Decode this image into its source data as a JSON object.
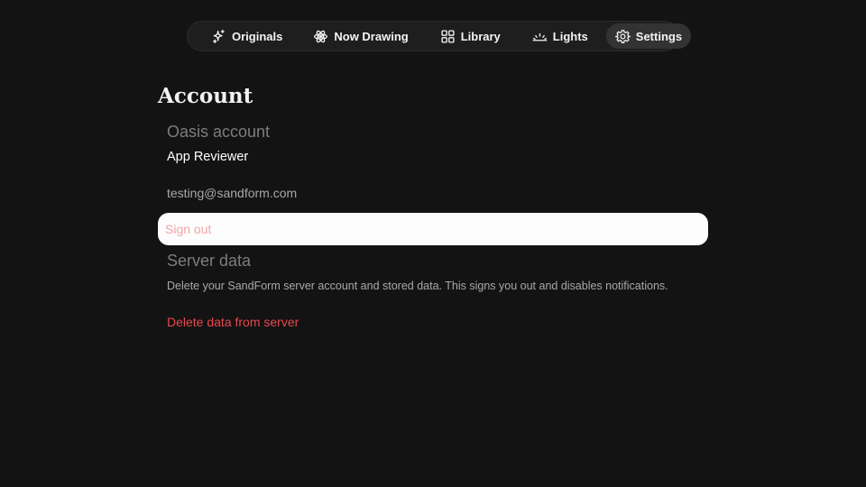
{
  "tabs": [
    {
      "id": "originals",
      "label": "Originals",
      "icon": "sparkles-icon"
    },
    {
      "id": "now_drawing",
      "label": "Now Drawing",
      "icon": "atom-icon"
    },
    {
      "id": "library",
      "label": "Library",
      "icon": "grid-icon"
    },
    {
      "id": "lights",
      "label": "Lights",
      "icon": "sunrise-icon"
    },
    {
      "id": "settings",
      "label": "Settings",
      "icon": "gear-icon",
      "active": true
    }
  ],
  "account": {
    "heading": "Account",
    "oasis_label": "Oasis account",
    "name": "App Reviewer",
    "email": "testing@sandform.com",
    "sign_out_label": "Sign out"
  },
  "server": {
    "heading": "Server data",
    "description": "Delete your SandForm server account and stored data. This signs you out and disables notifications.",
    "delete_label": "Delete data from server"
  },
  "colors": {
    "background": "#131313",
    "tab_bar": "#1e1e1e",
    "active_tab": "#333333",
    "danger": "#e8474d",
    "sign_out_text": "#f3a5a8"
  }
}
